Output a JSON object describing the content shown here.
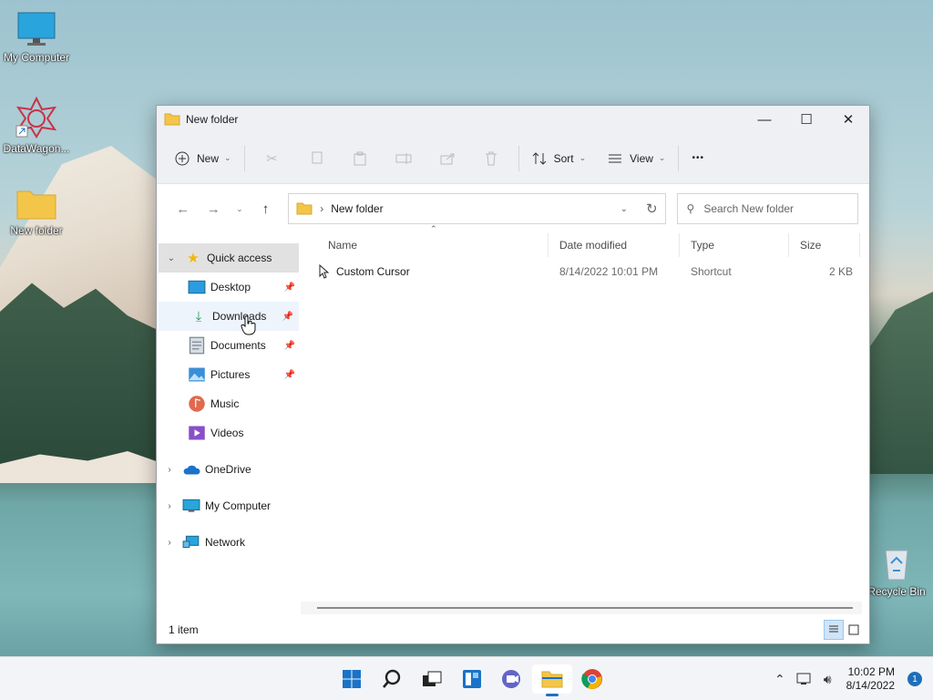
{
  "desktop": {
    "icons": [
      {
        "label": "My Computer"
      },
      {
        "label": "DataWagon..."
      },
      {
        "label": "New folder"
      },
      {
        "label": "Recycle Bin"
      }
    ]
  },
  "window": {
    "title": "New folder",
    "controls": {
      "minimize": "—",
      "maximize": "☐",
      "close": "✕"
    }
  },
  "toolbar": {
    "new_label": "New",
    "sort_label": "Sort",
    "view_label": "View",
    "more_label": "•••"
  },
  "address": {
    "path": "New folder",
    "search_placeholder": "Search New folder"
  },
  "sidebar": {
    "quick_access": "Quick access",
    "items": [
      {
        "label": "Desktop",
        "pinned": true
      },
      {
        "label": "Downloads",
        "pinned": true
      },
      {
        "label": "Documents",
        "pinned": true
      },
      {
        "label": "Pictures",
        "pinned": true
      },
      {
        "label": "Music",
        "pinned": false
      },
      {
        "label": "Videos",
        "pinned": false
      }
    ],
    "onedrive": "OneDrive",
    "my_computer": "My Computer",
    "network": "Network"
  },
  "files": {
    "columns": [
      "Name",
      "Date modified",
      "Type",
      "Size"
    ],
    "rows": [
      {
        "name": "Custom Cursor",
        "date": "8/14/2022 10:01 PM",
        "type": "Shortcut",
        "size": "2 KB"
      }
    ]
  },
  "status": {
    "count": "1 item"
  },
  "taskbar": {
    "time": "10:02 PM",
    "date": "8/14/2022",
    "notifications": "1"
  },
  "colors": {
    "accent": "#1a73c7",
    "folder": "#f3c64a"
  }
}
